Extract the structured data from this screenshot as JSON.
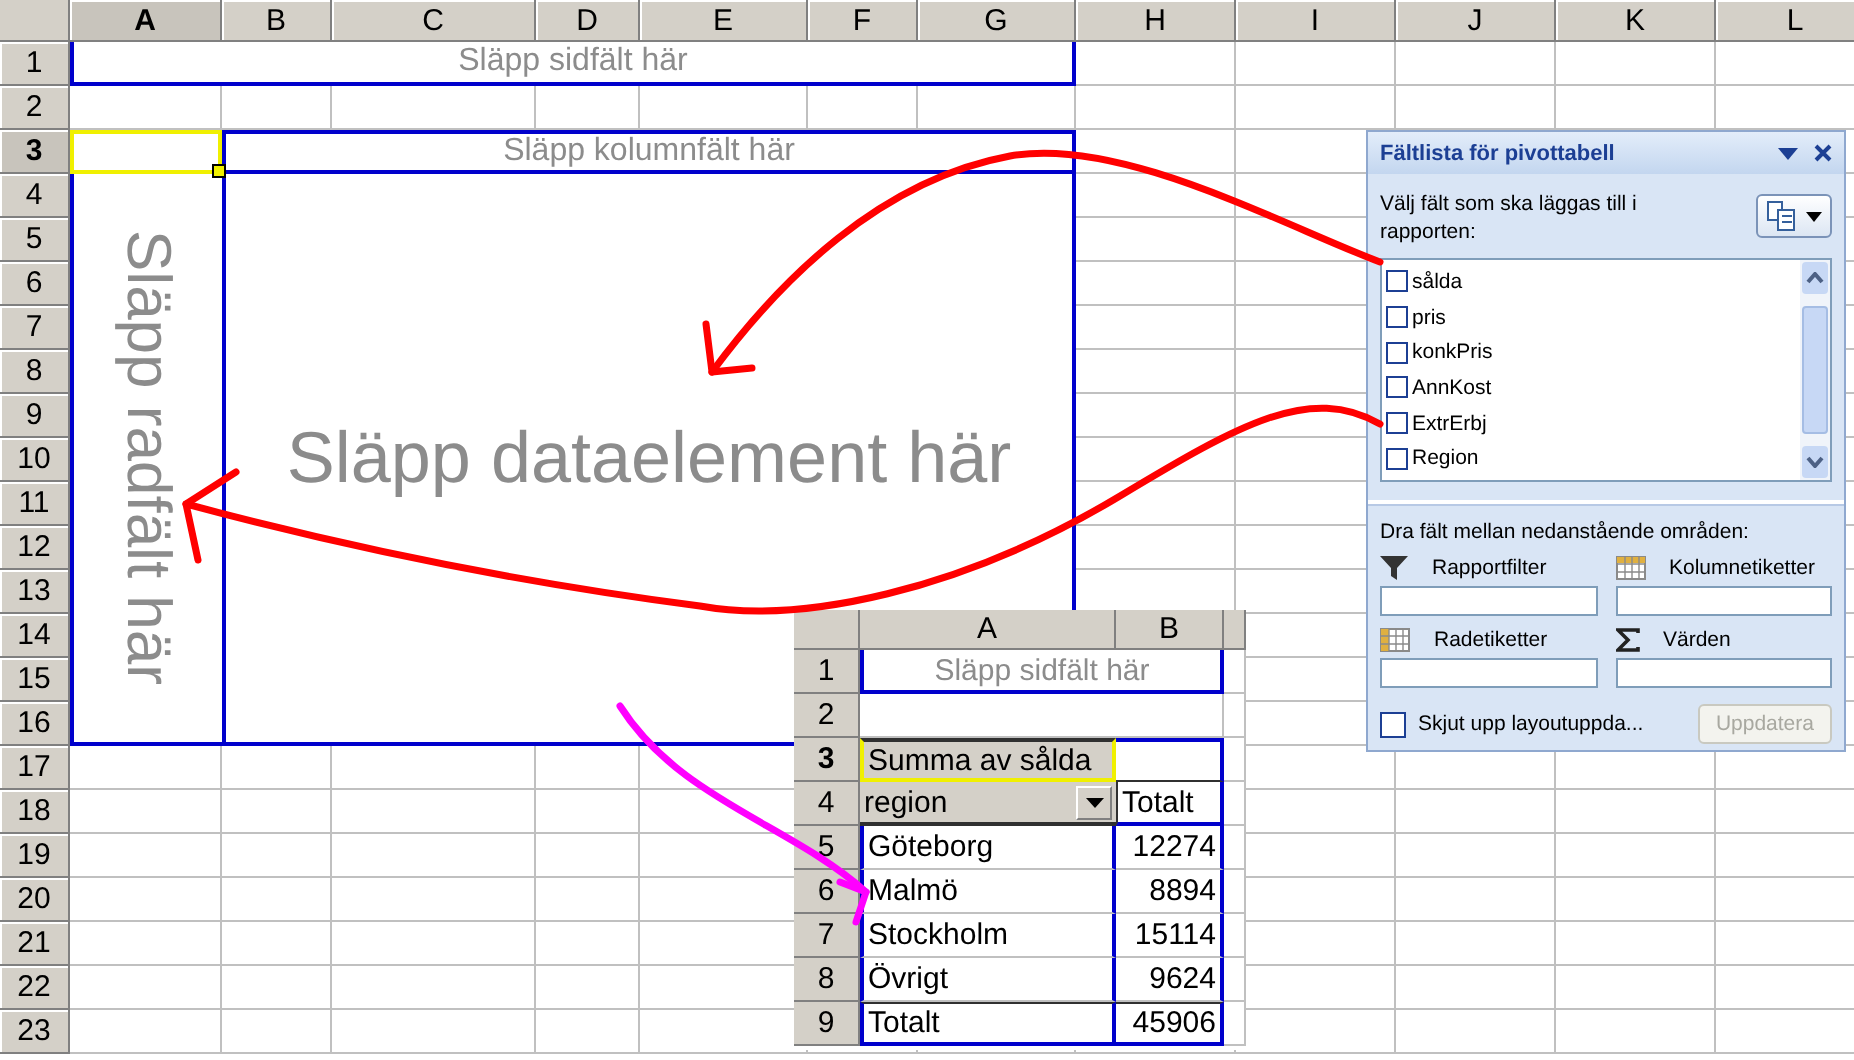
{
  "sheet": {
    "columns": [
      {
        "label": "A",
        "selected": true
      },
      {
        "label": "B",
        "selected": false
      },
      {
        "label": "C",
        "selected": false
      },
      {
        "label": "D",
        "selected": false
      },
      {
        "label": "E",
        "selected": false
      },
      {
        "label": "F",
        "selected": false
      },
      {
        "label": "G",
        "selected": false
      },
      {
        "label": "H",
        "selected": false
      },
      {
        "label": "I",
        "selected": false
      },
      {
        "label": "J",
        "selected": false
      },
      {
        "label": "K",
        "selected": false
      },
      {
        "label": "L",
        "selected": false
      }
    ],
    "rows": [
      {
        "label": "1",
        "selected": false
      },
      {
        "label": "2",
        "selected": false
      },
      {
        "label": "3",
        "selected": true
      },
      {
        "label": "4",
        "selected": false
      },
      {
        "label": "5",
        "selected": false
      },
      {
        "label": "6",
        "selected": false
      },
      {
        "label": "7",
        "selected": false
      },
      {
        "label": "8",
        "selected": false
      },
      {
        "label": "9",
        "selected": false
      },
      {
        "label": "10",
        "selected": false
      },
      {
        "label": "11",
        "selected": false
      },
      {
        "label": "12",
        "selected": false
      },
      {
        "label": "13",
        "selected": false
      },
      {
        "label": "14",
        "selected": false
      },
      {
        "label": "15",
        "selected": false
      },
      {
        "label": "16",
        "selected": false
      },
      {
        "label": "17",
        "selected": false
      },
      {
        "label": "18",
        "selected": false
      },
      {
        "label": "19",
        "selected": false
      },
      {
        "label": "20",
        "selected": false
      },
      {
        "label": "21",
        "selected": false
      },
      {
        "label": "22",
        "selected": false
      },
      {
        "label": "23",
        "selected": false
      }
    ],
    "drop_zones": {
      "page": "Släpp sidfält här",
      "column": "Släpp kolumnfält här",
      "row": "Släpp radfält här",
      "data": "Släpp dataelement här"
    }
  },
  "field_list": {
    "title": "Fältlista för pivottabell",
    "instruction": "Välj fält som ska läggas till i rapporten:",
    "fields": [
      {
        "label": "sålda",
        "checked": false
      },
      {
        "label": "pris",
        "checked": false
      },
      {
        "label": "konkPris",
        "checked": false
      },
      {
        "label": "AnnKost",
        "checked": false
      },
      {
        "label": "ExtrErbj",
        "checked": false
      },
      {
        "label": "Region",
        "checked": false
      }
    ],
    "areas_instruction": "Dra fält mellan nedanstående områden:",
    "areas": [
      {
        "kind": "filter",
        "label": "Rapportfilter"
      },
      {
        "kind": "columns",
        "label": "Kolumnetiketter"
      },
      {
        "kind": "rows",
        "label": "Radetiketter"
      },
      {
        "kind": "values",
        "label": "Värden"
      }
    ],
    "defer": {
      "label": "Skjut upp layoutuppda...",
      "checked": false
    },
    "update_button": {
      "label": "Uppdatera",
      "disabled": true
    }
  },
  "inset": {
    "columns": [
      "A",
      "B"
    ],
    "rows": [
      {
        "label": "1",
        "selected": false
      },
      {
        "label": "2",
        "selected": false
      },
      {
        "label": "3",
        "selected": true
      },
      {
        "label": "4",
        "selected": false
      },
      {
        "label": "5",
        "selected": false
      },
      {
        "label": "6",
        "selected": false
      },
      {
        "label": "7",
        "selected": false
      },
      {
        "label": "8",
        "selected": false
      },
      {
        "label": "9",
        "selected": false
      }
    ],
    "page_zone": "Släpp sidfält här",
    "data_caption": "Summa av sålda",
    "row_field": "region",
    "total_header": "Totalt",
    "data": [
      {
        "label": "Göteborg",
        "value": "12274"
      },
      {
        "label": "Malmö",
        "value": "8894"
      },
      {
        "label": "Stockholm",
        "value": "15114"
      },
      {
        "label": "Övrigt",
        "value": "9624"
      },
      {
        "label": "Totalt",
        "value": "45906"
      }
    ]
  }
}
